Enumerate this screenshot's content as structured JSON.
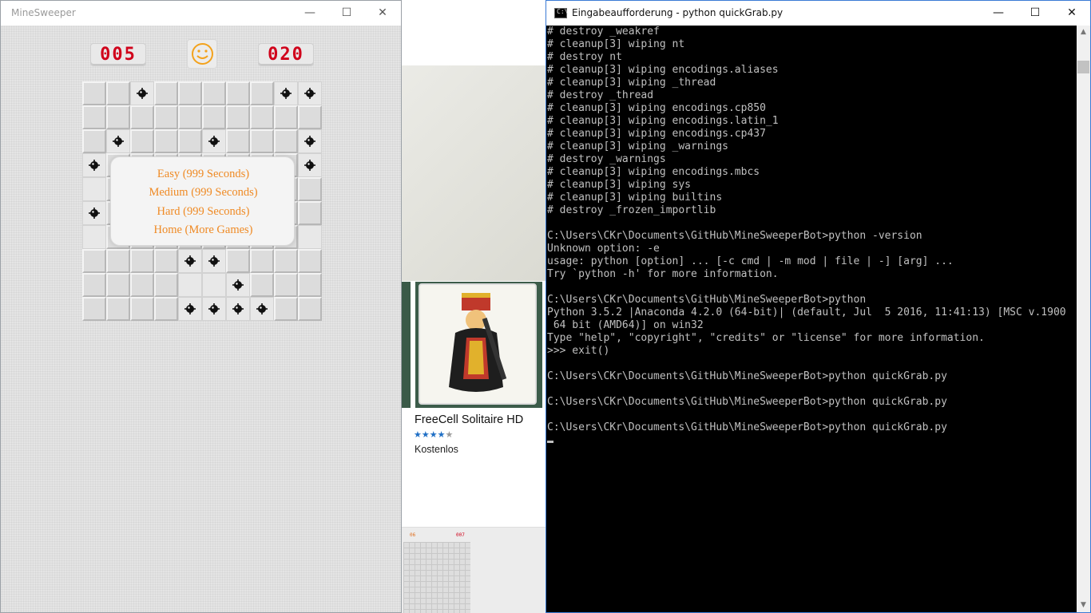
{
  "minesweeper": {
    "title": "MineSweeper",
    "controls": {
      "minimize": "—",
      "maximize": "☐",
      "close": "✕"
    },
    "mine_counter": "005",
    "timer": "020",
    "face": "smiley-face-icon",
    "grid": {
      "rows": 10,
      "cols": 10,
      "mines": [
        [
          0,
          2
        ],
        [
          0,
          8
        ],
        [
          0,
          9
        ],
        [
          2,
          1
        ],
        [
          2,
          5
        ],
        [
          2,
          9
        ],
        [
          3,
          0
        ],
        [
          3,
          9
        ],
        [
          5,
          0
        ],
        [
          7,
          4
        ],
        [
          7,
          5
        ],
        [
          8,
          6
        ],
        [
          9,
          4
        ],
        [
          9,
          5
        ],
        [
          9,
          6
        ],
        [
          9,
          7
        ]
      ],
      "open_cells": [
        [
          0,
          2
        ],
        [
          0,
          8
        ],
        [
          0,
          9
        ],
        [
          2,
          1
        ],
        [
          2,
          5
        ],
        [
          2,
          9
        ],
        [
          3,
          0
        ],
        [
          3,
          9
        ],
        [
          4,
          0
        ],
        [
          5,
          0
        ],
        [
          6,
          0
        ],
        [
          6,
          9
        ],
        [
          7,
          4
        ],
        [
          7,
          5
        ],
        [
          8,
          4
        ],
        [
          8,
          5
        ],
        [
          8,
          6
        ],
        [
          9,
          4
        ],
        [
          9,
          5
        ],
        [
          9,
          6
        ],
        [
          9,
          7
        ]
      ]
    },
    "menu": {
      "easy": "Easy   (999 Seconds)",
      "medium": "Medium   (999 Seconds)",
      "hard": "Hard   (999 Seconds)",
      "home": "Home (More Games)"
    },
    "colors": {
      "counter_digits": "#d0021b",
      "menu_text": "#ef8a24"
    }
  },
  "store": {
    "app_name": "FreeCell Solitaire HD",
    "stars": "★★★★★",
    "rating_stars": 4,
    "price": "Kostenlos",
    "thumb_left_counter": "06",
    "thumb_right_counter": "007"
  },
  "console": {
    "title": "Eingabeaufforderung - python  quickGrab.py",
    "icon_label": "C:\\",
    "controls": {
      "minimize": "—",
      "maximize": "☐",
      "close": "✕"
    },
    "lines": [
      "# destroy _weakref",
      "# cleanup[3] wiping nt",
      "# destroy nt",
      "# cleanup[3] wiping encodings.aliases",
      "# cleanup[3] wiping _thread",
      "# destroy _thread",
      "# cleanup[3] wiping encodings.cp850",
      "# cleanup[3] wiping encodings.latin_1",
      "# cleanup[3] wiping encodings.cp437",
      "# cleanup[3] wiping _warnings",
      "# destroy _warnings",
      "# cleanup[3] wiping encodings.mbcs",
      "# cleanup[3] wiping sys",
      "# cleanup[3] wiping builtins",
      "# destroy _frozen_importlib",
      "",
      "C:\\Users\\CKr\\Documents\\GitHub\\MineSweeperBot>python -version",
      "Unknown option: -e",
      "usage: python [option] ... [-c cmd | -m mod | file | -] [arg] ...",
      "Try `python -h' for more information.",
      "",
      "C:\\Users\\CKr\\Documents\\GitHub\\MineSweeperBot>python",
      "Python 3.5.2 |Anaconda 4.2.0 (64-bit)| (default, Jul  5 2016, 11:41:13) [MSC v.1900",
      " 64 bit (AMD64)] on win32",
      "Type \"help\", \"copyright\", \"credits\" or \"license\" for more information.",
      ">>> exit()",
      "",
      "C:\\Users\\CKr\\Documents\\GitHub\\MineSweeperBot>python quickGrab.py",
      "",
      "C:\\Users\\CKr\\Documents\\GitHub\\MineSweeperBot>python quickGrab.py",
      "",
      "C:\\Users\\CKr\\Documents\\GitHub\\MineSweeperBot>python quickGrab.py",
      ""
    ],
    "scroll_up": "▲",
    "scroll_down": "▼"
  }
}
